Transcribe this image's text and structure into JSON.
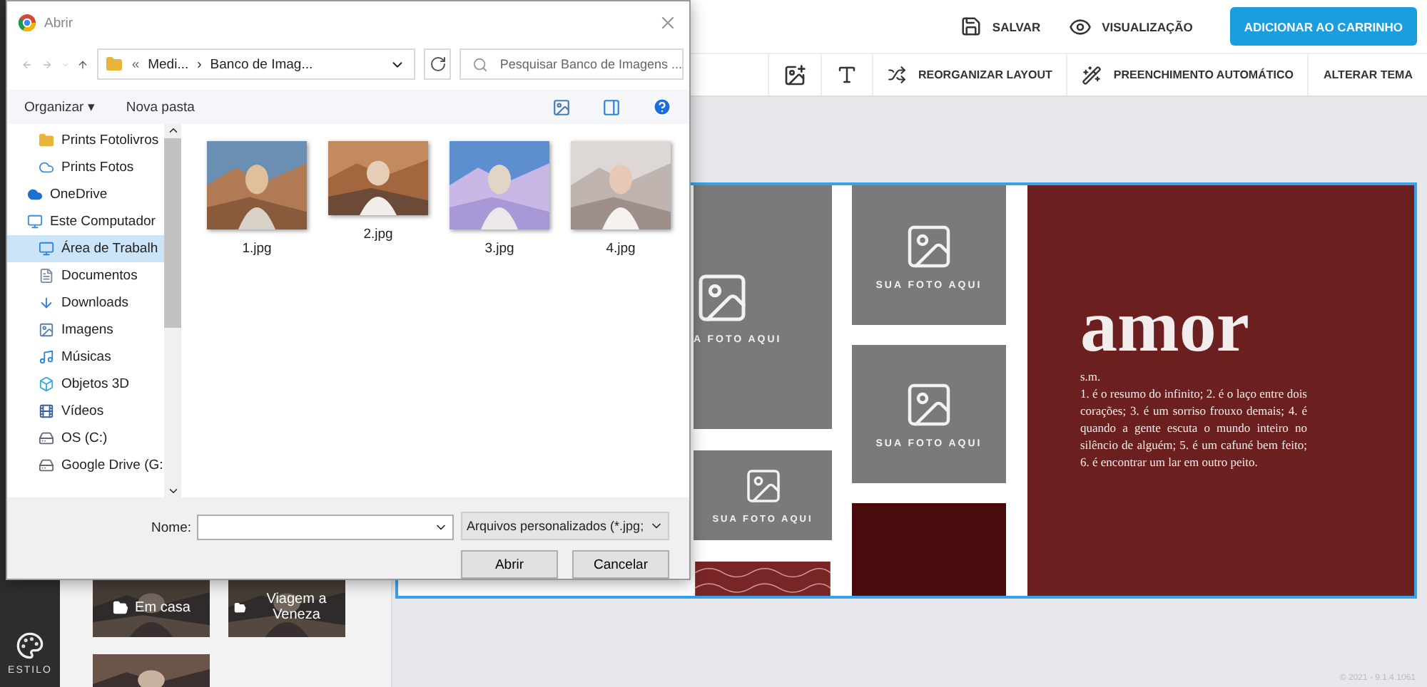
{
  "app": {
    "top_actions": [
      {
        "kind": "save",
        "label": "SALVAR"
      },
      {
        "kind": "preview",
        "label": "VISUALIZAÇÃO"
      }
    ],
    "cart_button": "ADICIONAR AO CARRINHO",
    "toolbar": [
      {
        "kind": "add-image"
      },
      {
        "kind": "add-text"
      },
      {
        "kind": "shuffle",
        "label": "REORGANIZAR LAYOUT"
      },
      {
        "kind": "wand",
        "label": "PREENCHIMENTO AUTOMÁTICO"
      },
      {
        "kind": "plain",
        "label": "ALTERAR TEMA"
      }
    ],
    "rail": [
      {
        "label": "ESTILO"
      }
    ],
    "folders": [
      {
        "label": "Em casa"
      },
      {
        "label": "Viagem a Veneza"
      },
      {
        "kind": "picture"
      }
    ],
    "spread": {
      "placeholders": [
        "A FOTO AQUI",
        "SUA FOTO AQUI",
        "SUA FOTO AQUI",
        "SUA FOTO AQUI"
      ],
      "title": "amor",
      "grammar": "s.m.",
      "definition": "1. é o resumo do infinito; 2. é o laço entre dois corações; 3. é um sorriso frouxo demais; 4. é quando a gente escuta o mundo inteiro no silêncio de alguém; 5. é um cafuné bem feito; 6. é encontrar um lar em outro peito."
    },
    "version": "© 2021 - 9.1.4.1061"
  },
  "dialog": {
    "title": "Abrir",
    "path_overflow": "«",
    "path_separator": "›",
    "path": [
      "Medi...",
      "Banco de Imag..."
    ],
    "search": {
      "placeholder": "Pesquisar Banco de Imagens ..."
    },
    "commands": [
      "Organizar",
      "Nova pasta"
    ],
    "menu_caret": "▾",
    "nav_tree": [
      {
        "kind": "folder",
        "label": "Prints Fotolivros",
        "selected": false
      },
      {
        "kind": "cloud-folder",
        "label": "Prints Fotos",
        "selected": false
      },
      {
        "kind": "onedrive",
        "label": "OneDrive",
        "selected": false
      },
      {
        "kind": "computer",
        "label": "Este Computador",
        "selected": false,
        "children": [
          {
            "kind": "desktop",
            "label": "Área de Trabalh",
            "selected": true
          },
          {
            "kind": "documents",
            "label": "Documentos",
            "selected": false
          },
          {
            "kind": "downloads",
            "label": "Downloads",
            "selected": false
          },
          {
            "kind": "pictures",
            "label": "Imagens",
            "selected": false
          },
          {
            "kind": "music",
            "label": "Músicas",
            "selected": false
          },
          {
            "kind": "objects",
            "label": "Objetos 3D",
            "selected": false
          },
          {
            "kind": "videos",
            "label": "Vídeos",
            "selected": false
          },
          {
            "kind": "drive",
            "label": "OS (C:)",
            "selected": false
          },
          {
            "kind": "drive",
            "label": "Google Drive (G:",
            "selected": false
          }
        ]
      }
    ],
    "files": [
      {
        "name": "1.jpg"
      },
      {
        "name": "2.jpg"
      },
      {
        "name": "3.jpg"
      },
      {
        "name": "4.jpg"
      }
    ],
    "name_label": "Nome:",
    "file_type": "Arquivos personalizados (*.jpg;",
    "buttons": [
      "Abrir",
      "Cancelar"
    ]
  }
}
